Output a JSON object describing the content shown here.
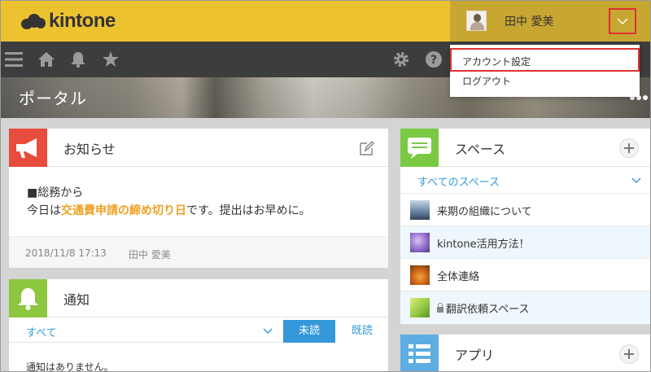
{
  "header": {
    "logo_text": "kintone",
    "user_name": "田中 愛美"
  },
  "user_menu": {
    "items": [
      {
        "label": "アカウント設定"
      },
      {
        "label": "ログアウト"
      }
    ]
  },
  "toolbar": {
    "icons": [
      "menu-icon",
      "home-icon",
      "bell-icon",
      "star-icon",
      "gear-icon",
      "help-icon"
    ]
  },
  "banner": {
    "title": "ポータル"
  },
  "notice_panel": {
    "title": "お知らせ",
    "line1": "■総務から",
    "line2_prefix": "今日は",
    "line2_highlight": "交通費申請の締め切り日",
    "line2_suffix": "です。提出はお早めに。",
    "date": "2018/11/8 17:13",
    "author": "田中 愛美"
  },
  "notification_panel": {
    "title": "通知",
    "filter": "すべて",
    "unread_button": "未読",
    "read_button": "既読",
    "empty_message": "通知はありません。"
  },
  "spaces_panel": {
    "title": "スペース",
    "filter": "すべてのスペース",
    "items": [
      {
        "label": "来期の組織について"
      },
      {
        "label": "kintone活用方法！"
      },
      {
        "label": "全体連絡"
      },
      {
        "label": "翻訳依頼スペース",
        "locked": true
      }
    ]
  },
  "apps_panel": {
    "title": "アプリ"
  },
  "colors": {
    "header_yellow": "#ecc22f",
    "toolbar_dark": "#3d3d3d",
    "link_blue": "#3498db",
    "highlight_orange": "#f0a020",
    "notice_red": "#e74c3c",
    "notify_green": "#8dc63f",
    "space_green": "#7ac943",
    "app_blue": "#5dade2",
    "selection_red": "#e03030"
  }
}
